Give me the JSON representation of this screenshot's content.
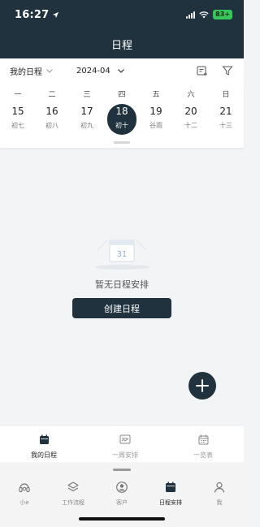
{
  "status_bar": {
    "time": "16:27",
    "battery": "83+"
  },
  "header": {
    "title": "日程"
  },
  "filter": {
    "scope_label": "我的日程",
    "month_label": "2024-04",
    "add_icon": "calendar-add-icon",
    "filter_icon": "filter-icon"
  },
  "week": {
    "days": [
      {
        "weekday": "一",
        "date": "15",
        "lunar": "初七",
        "selected": false
      },
      {
        "weekday": "二",
        "date": "16",
        "lunar": "初八",
        "selected": false
      },
      {
        "weekday": "三",
        "date": "17",
        "lunar": "初九",
        "selected": false
      },
      {
        "weekday": "四",
        "date": "18",
        "lunar": "初十",
        "selected": true
      },
      {
        "weekday": "五",
        "date": "19",
        "lunar": "谷雨",
        "selected": false
      },
      {
        "weekday": "六",
        "date": "20",
        "lunar": "十二",
        "selected": false
      },
      {
        "weekday": "日",
        "date": "21",
        "lunar": "十三",
        "selected": false
      }
    ]
  },
  "empty_state": {
    "illustration_number": "31",
    "text": "暂无日程安排",
    "create_label": "创建日程"
  },
  "sub_tabs": [
    {
      "label": "我的日程",
      "icon": "calendar-icon",
      "active": true
    },
    {
      "label": "一周安排",
      "icon": "week-schedule-icon",
      "active": false
    },
    {
      "label": "一览表",
      "icon": "calendar-overview-icon",
      "active": false
    }
  ],
  "bottom_nav": [
    {
      "label": "小e",
      "icon": "headset-icon",
      "active": false
    },
    {
      "label": "工作流程",
      "icon": "layers-icon",
      "active": false
    },
    {
      "label": "客户",
      "icon": "user-circle-icon",
      "active": false
    },
    {
      "label": "日程安排",
      "icon": "calendar-icon",
      "active": true
    },
    {
      "label": "我",
      "icon": "person-icon",
      "active": false
    }
  ],
  "colors": {
    "primary": "#1f323d",
    "background": "#f3f4f6",
    "battery": "#35c759"
  }
}
